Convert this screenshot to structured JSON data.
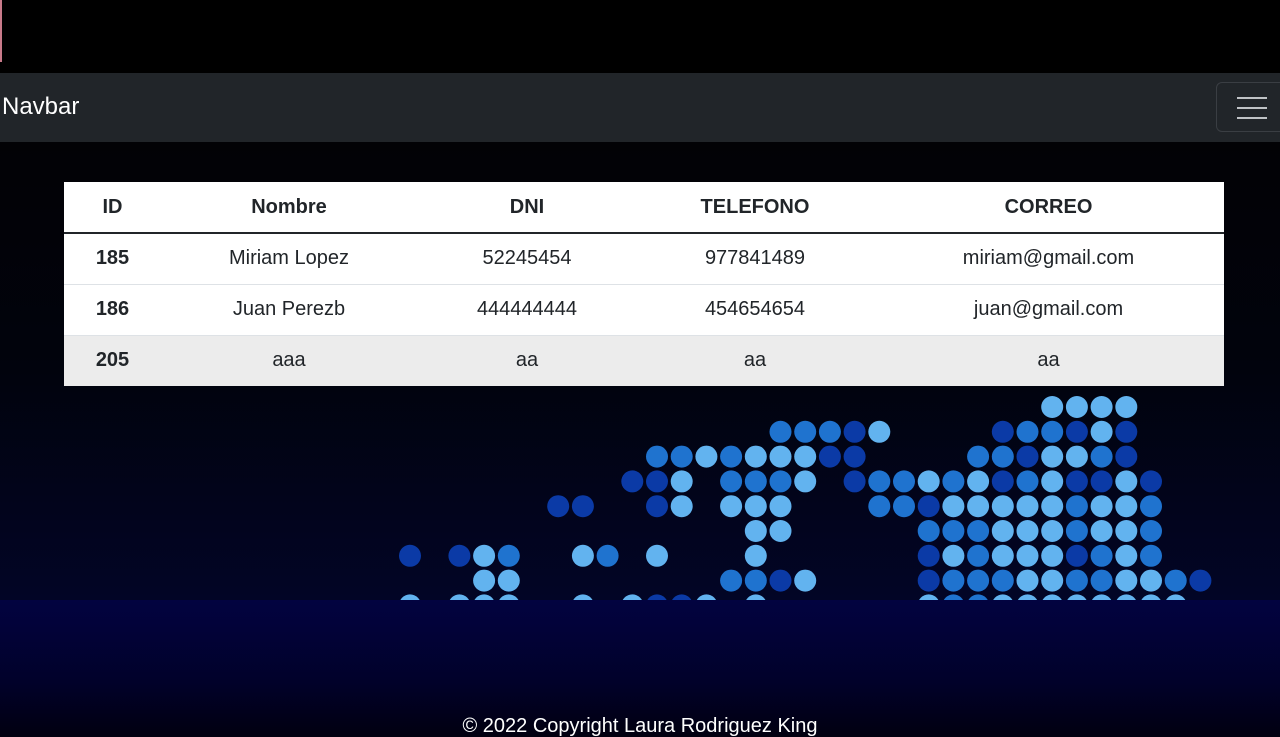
{
  "navbar": {
    "brand": "Navbar",
    "toggler_icon": "hamburger-icon"
  },
  "table": {
    "headers": [
      "ID",
      "Nombre",
      "DNI",
      "TELEFONO",
      "CORREO"
    ],
    "rows": [
      [
        "185",
        "Miriam Lopez",
        "52245454",
        "977841489",
        "miriam@gmail.com"
      ],
      [
        "186",
        "Juan Perezb",
        "444444444",
        "454654654",
        "juan@gmail.com"
      ],
      [
        "205",
        "aaa",
        "aa",
        "aa",
        "aa"
      ]
    ]
  },
  "footer": {
    "text": "© 2022 Copyright Laura Rodriguez King"
  },
  "colors": {
    "navbar_bg": "#212529",
    "dot_light": "#62b3ef",
    "dot_mid": "#1f73cf",
    "dot_dark": "#0b3aa6"
  }
}
